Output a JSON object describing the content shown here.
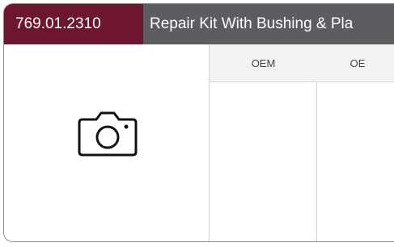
{
  "product": {
    "part_number": "769.01.2310",
    "title": "Repair Kit With Bushing & Pla"
  },
  "image": {
    "icon": "camera-icon"
  },
  "table": {
    "headers": [
      "OEM",
      "OE"
    ]
  },
  "colors": {
    "part_number_bg": "#6e1530",
    "header_bg": "#5b5d60",
    "table_header_bg": "#f2f2f2"
  }
}
